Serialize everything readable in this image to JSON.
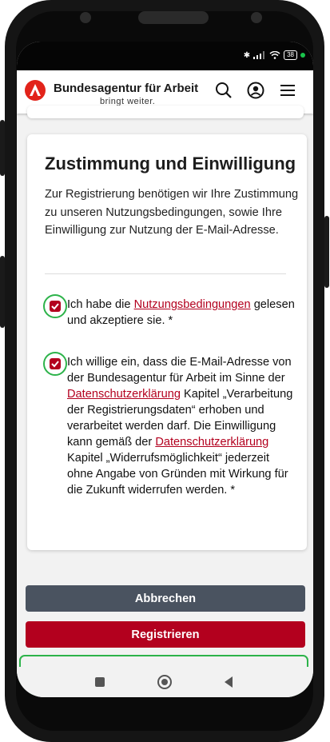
{
  "status_bar": {
    "icons": [
      "bluetooth-icon",
      "signal-icon",
      "wifi-icon",
      "battery-icon"
    ],
    "battery": "38"
  },
  "app_bar": {
    "brand_name": "Bundesagentur für Arbeit",
    "tagline": "bringt weiter.",
    "icons": [
      "search-icon",
      "account-icon",
      "menu-icon"
    ],
    "brand_color": "#e2231a"
  },
  "consent": {
    "title": "Zustimmung und Einwilligung",
    "intro": "Zur Registrierung benötigen wir Ihre Zustimmung zu unseren Nutzungsbedingungen, sowie Ihre Einwilligung zur Nutzung der E-Mail-Adresse.",
    "terms": {
      "checked": true,
      "text_before": "Ich habe die ",
      "link": "Nutzungsbedingungen",
      "text_after": " gelesen und akzeptiere sie. *"
    },
    "email": {
      "checked": true,
      "text_1": "Ich willige ein, dass die E-Mail-Adresse von der Bundesagentur für Arbeit im Sinne der ",
      "link_1": "Datenschutzerklärung",
      "text_2": " Kapitel „Verarbeitung der Registrierungsdaten“ erhoben und verarbeitet werden darf. Die Einwilligung kann gemäß der ",
      "link_2": "Datenschutzerklärung",
      "text_3": " Kapitel „Widerrufsmöglichkeit“ jederzeit ohne Angabe von Gründen mit Wirkung für die Zukunft widerrufen werden. *"
    }
  },
  "buttons": {
    "cancel": "Abbrechen",
    "register": "Registrieren",
    "cancel_color": "#4a5360",
    "register_color": "#b3001e"
  },
  "nav_bar": {
    "icons": [
      "recents-icon",
      "home-icon",
      "back-icon"
    ]
  }
}
